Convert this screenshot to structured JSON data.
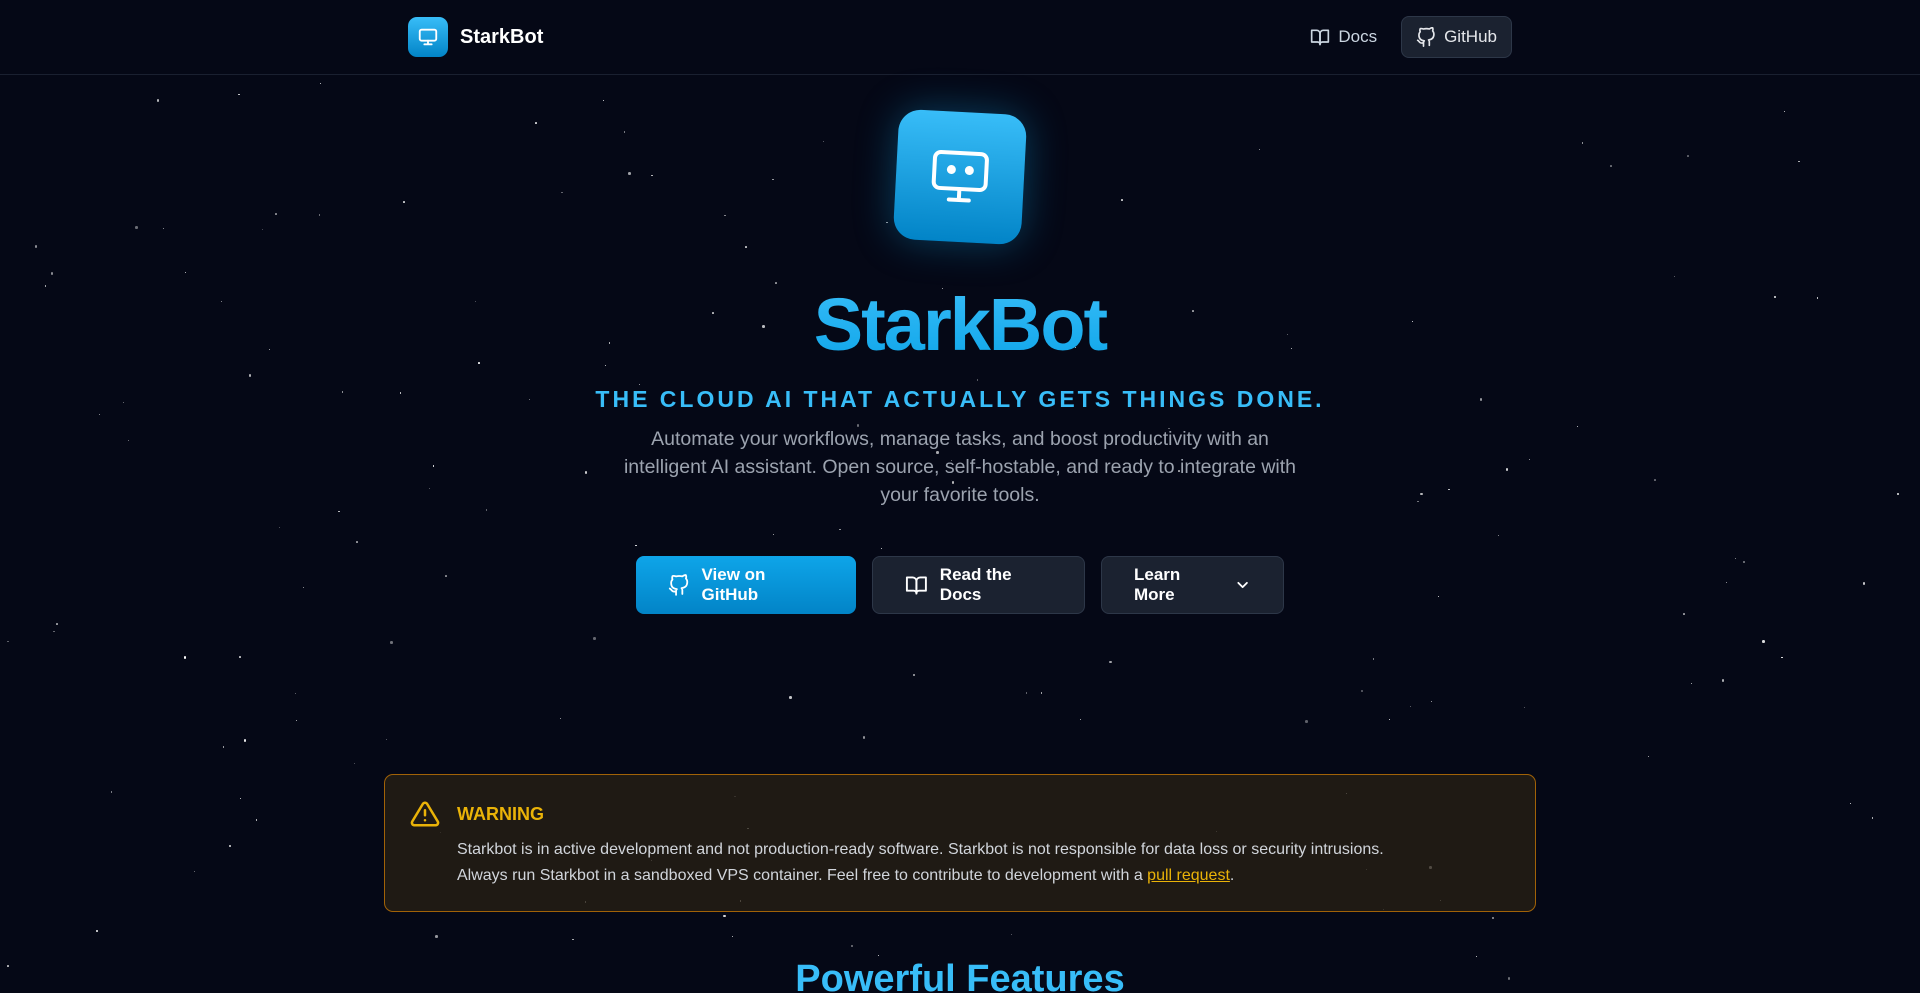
{
  "nav": {
    "brand": "StarkBot",
    "links": [
      {
        "label": "Docs",
        "icon": "book-icon"
      },
      {
        "label": "GitHub",
        "icon": "github-icon"
      }
    ]
  },
  "hero": {
    "title": "StarkBot",
    "tagline": "THE CLOUD AI THAT ACTUALLY GETS THINGS DONE.",
    "description": "Automate your workflows, manage tasks, and boost productivity with an intelligent AI assistant. Open source, self-hostable, and ready to integrate with your favorite tools.",
    "buttons": {
      "github": "View on GitHub",
      "docs": "Read the Docs",
      "learn": "Learn More"
    }
  },
  "warning": {
    "title": "WARNING",
    "line1": "Starkbot is in active development and not production-ready software. Starkbot is not responsible for data loss or security intrusions.",
    "line2_prefix": "Always run Starkbot in a sandboxed VPS container. Feel free to contribute to development with a ",
    "link": "pull request",
    "line2_suffix": "."
  },
  "features": {
    "title": "Powerful Features"
  },
  "colors": {
    "background": "#050816",
    "accent": "#38bdf8",
    "warning": "#eab308"
  }
}
